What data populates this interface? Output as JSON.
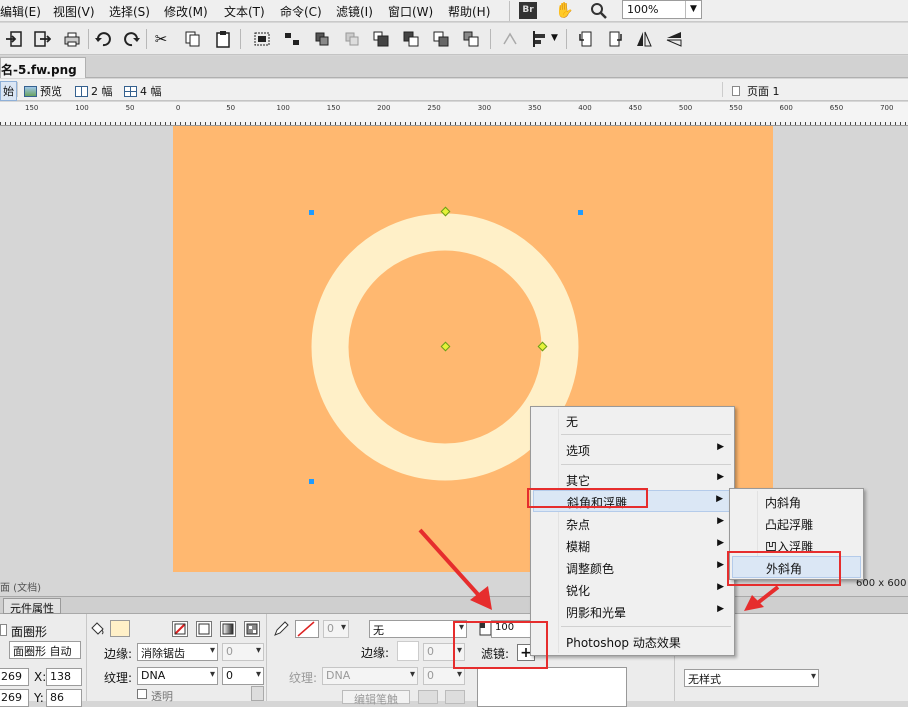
{
  "menubar": {
    "items": [
      "编辑(E)",
      "视图(V)",
      "选择(S)",
      "修改(M)",
      "文本(T)",
      "命令(C)",
      "滤镜(I)",
      "窗口(W)",
      "帮助(H)"
    ],
    "br_label": "Br",
    "zoom": "100%"
  },
  "document": {
    "tab_title": "名-5.fw.png"
  },
  "viewbar": {
    "original_label": "始",
    "preview_label": "预览",
    "two_up_label": "2 幅",
    "four_up_label": "4 幅",
    "page_label": "页面 1"
  },
  "ruler": {
    "ticks": [
      "150",
      "100",
      "50",
      "0",
      "50",
      "100",
      "150",
      "200",
      "250",
      "300",
      "350",
      "400",
      "450",
      "500",
      "550",
      "600",
      "650",
      "700"
    ]
  },
  "canvas": {
    "background": "#ffb870",
    "ring_color": "#fff0c8"
  },
  "status": {
    "doc_label": "面 (文档)",
    "canvas_size": "600 x 600"
  },
  "properties": {
    "tab_label": "元件属性",
    "shape_name": "面圈形",
    "shape_name2": "面圈形",
    "auto_label": "自动",
    "edge_label": "边缘:",
    "edge_value": "消除锯齿",
    "edge_amount": "0",
    "texture_label": "纹理:",
    "texture_value": "DNA",
    "texture_amount": "0",
    "transparent_label": "透明",
    "w_value": "269",
    "h_value": "269",
    "x_label": "X:",
    "x_value": "138",
    "y_label": "Y:",
    "y_value": "86",
    "stroke_size": "0",
    "stroke_type": "无",
    "stroke_edge_label": "边缘:",
    "stroke_edge_amount": "0",
    "stroke_texture_label": "纹理:",
    "stroke_texture_value": "DNA",
    "stroke_texture_amount": "0",
    "edit_brush_label": "编辑笔触",
    "opacity": "100",
    "filters_label": "滤镜:",
    "add_filter_symbol": "+",
    "style_value": "无样式"
  },
  "context_menu": {
    "items": [
      "无",
      "选项",
      "其它",
      "斜角和浮雕",
      "杂点",
      "模糊",
      "调整颜色",
      "锐化",
      "阴影和光晕",
      "Photoshop 动态效果"
    ],
    "highlighted": "斜角和浮雕"
  },
  "submenu": {
    "items": [
      "内斜角",
      "凸起浮雕",
      "凹入浮雕",
      "外斜角"
    ],
    "highlighted": "外斜角"
  },
  "colors": {
    "annotation_red": "#e62d2d",
    "fill_swatch": "#fff0c8",
    "selection_blue": "#1e9bff"
  }
}
